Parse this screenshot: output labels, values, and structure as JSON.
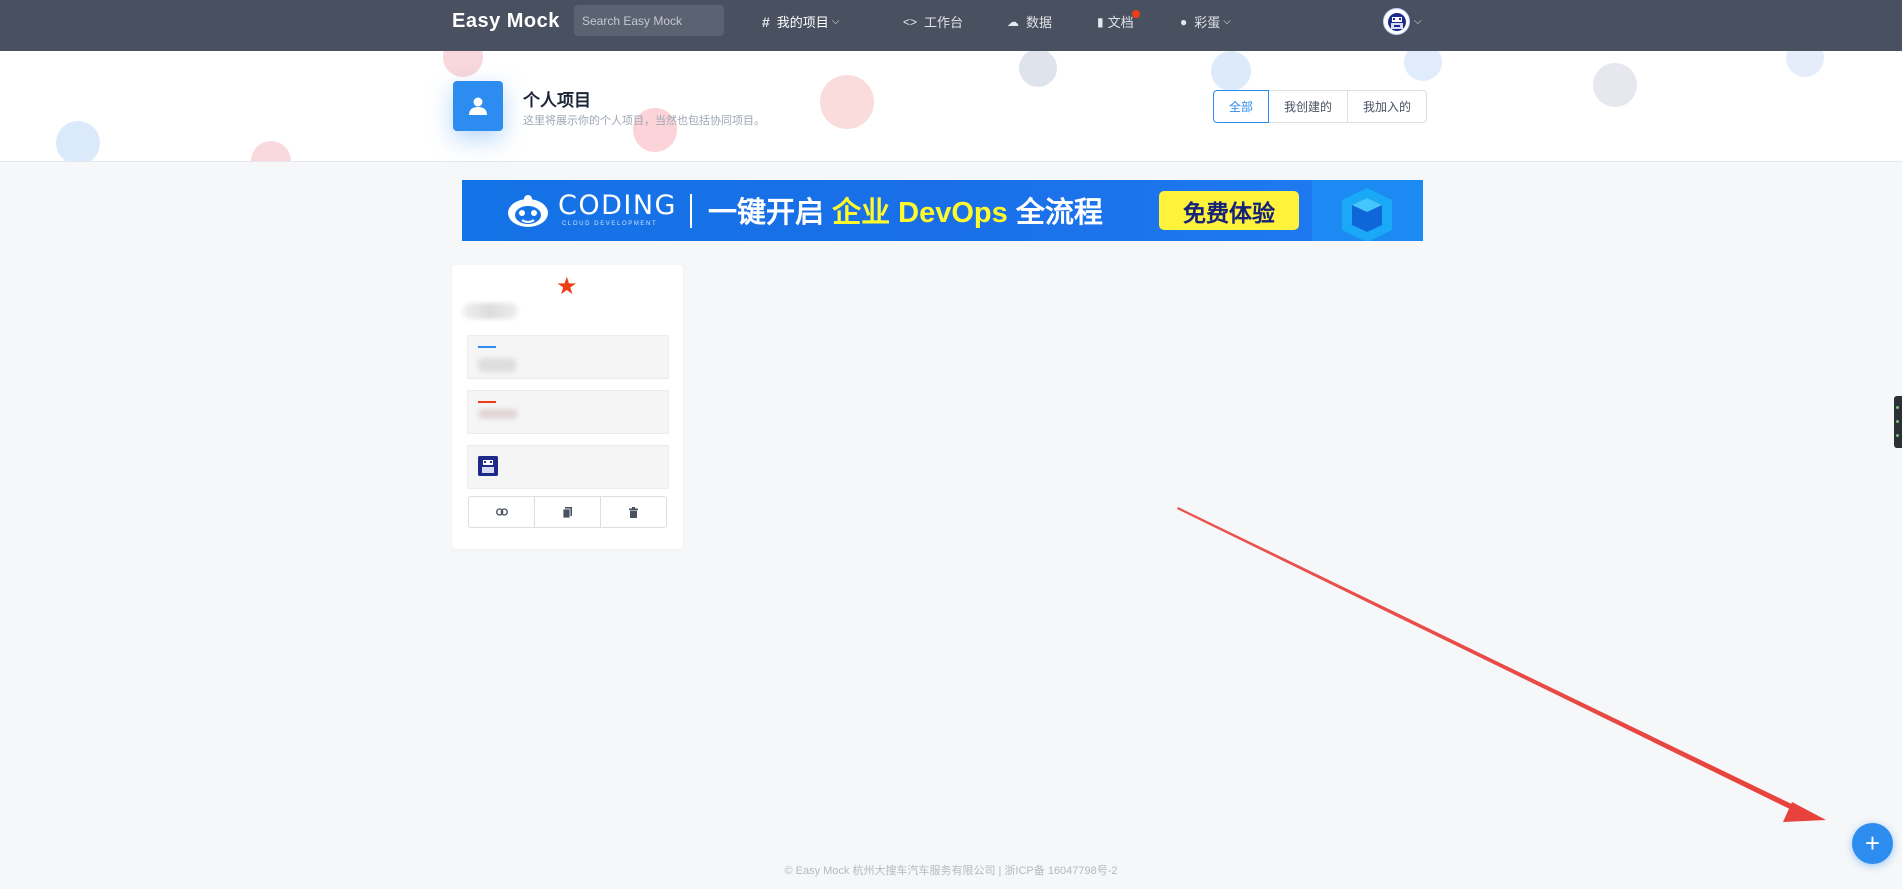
{
  "header": {
    "logo": "Easy Mock",
    "search_placeholder": "Search Easy Mock",
    "nav": {
      "my_projects": "我的项目",
      "workbench": "工作台",
      "data": "数据",
      "docs": "文档",
      "easter_egg": "彩蛋"
    }
  },
  "page_head": {
    "title": "个人项目",
    "subtitle": "这里将展示你的个人项目，当然也包括协同项目。",
    "filters": [
      "全部",
      "我创建的",
      "我加入的"
    ],
    "active_filter": "全部"
  },
  "banner": {
    "brand": "CODING",
    "brand_sub": "CLOUD DEVELOPMENT",
    "slogan_prefix": "一键开启",
    "slogan_highlight": "企业 DevOps",
    "slogan_suffix": "全流程",
    "cta": "免费体验"
  },
  "project_card": {
    "starred": true,
    "accent_blue": "#2d8cf0",
    "accent_red": "#ed3f14"
  },
  "fab": {
    "label": "+"
  },
  "footer": {
    "text": "© Easy Mock 杭州大搜车汽车服务有限公司 | 浙ICP备 16047798号-2"
  },
  "colors": {
    "topbar": "#495060",
    "primary": "#2d8cf0",
    "page_bg": "#f5f7f9",
    "annotation_arrow": "#e8423c"
  }
}
